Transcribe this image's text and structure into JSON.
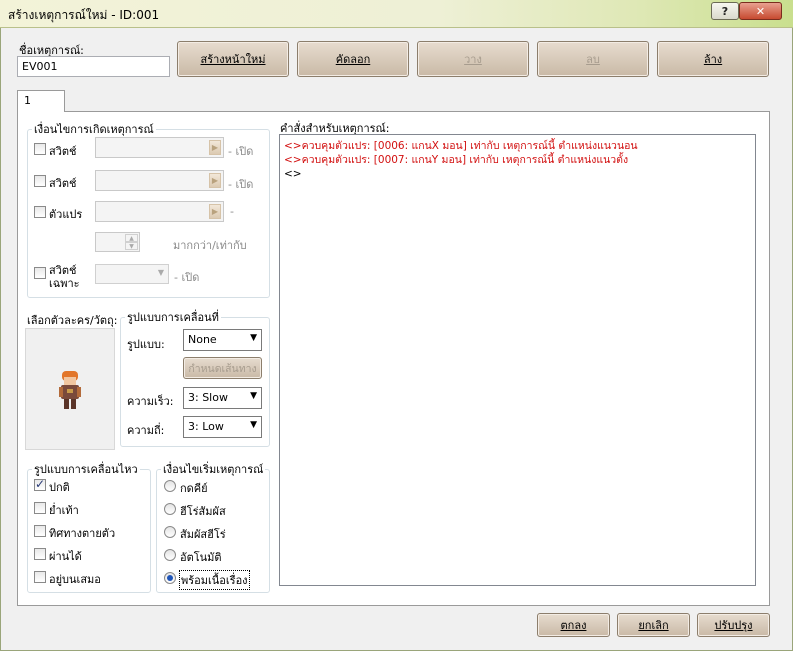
{
  "window": {
    "title": "สร้างเหตุการณ์ใหม่ - ID:001",
    "help_label": "?",
    "close_label": "✕"
  },
  "event_name": {
    "label": "ชื่อเหตุการณ์:",
    "value": "EV001"
  },
  "toolbar": {
    "new_page": "สร้างหน้าใหม่",
    "copy": "คัดลอก",
    "paste": "วาง",
    "delete": "ลบ",
    "clear": "ล้าง"
  },
  "tabs": [
    {
      "label": "1"
    }
  ],
  "conditions": {
    "title": "เงื่อนไขการเกิดเหตุการณ์",
    "switch1": {
      "label": "สวิตช์",
      "suffix": "- เปิด"
    },
    "switch2": {
      "label": "สวิตช์",
      "suffix": "- เปิด"
    },
    "variable": {
      "label": "ตัวแปร",
      "suffix": "-",
      "compare": "มากกว่า/เท่ากับ"
    },
    "self_switch": {
      "label_line1": "สวิตช์",
      "label_line2": "เฉพาะ",
      "suffix": "- เปิด"
    }
  },
  "graphic": {
    "label": "เลือกตัวละคร/วัตถุ:"
  },
  "movement": {
    "title": "รูปแบบการเคลื่อนที่",
    "type_label": "รูปแบบ:",
    "type_value": "None",
    "route_button": "กำหนดเส้นทาง",
    "speed_label": "ความเร็ว:",
    "speed_value": "3: Slow",
    "freq_label": "ความถี่:",
    "freq_value": "3: Low"
  },
  "options": {
    "title": "รูปแบบการเคลื่อนไหว",
    "items": [
      {
        "label": "ปกติ",
        "checked": true
      },
      {
        "label": "ย่ำเท้า",
        "checked": false
      },
      {
        "label": "ทิศทางตายตัว",
        "checked": false
      },
      {
        "label": "ผ่านได้",
        "checked": false
      },
      {
        "label": "อยู่บนเสมอ",
        "checked": false
      }
    ]
  },
  "trigger": {
    "title": "เงื่อนไขเริ่มเหตุการณ์",
    "items": [
      {
        "label": "กดคีย์",
        "selected": false
      },
      {
        "label": "ฮีโร่สัมผัส",
        "selected": false
      },
      {
        "label": "สัมผัสฮีโร่",
        "selected": false
      },
      {
        "label": "อัตโนมัติ",
        "selected": false
      },
      {
        "label": "พร้อมเนื้อเรื่อง",
        "selected": true
      }
    ]
  },
  "commands": {
    "label": "คำสั่งสำหรับเหตุการณ์:",
    "lines": [
      "<>ควบคุมตัวแปร: [0006: แกนX มอน] เท่ากับ เหตุการณ์นี้ ตำแหน่งแนวนอน",
      "<>ควบคุมตัวแปร: [0007: แกนY มอน] เท่ากับ เหตุการณ์นี้ ตำแหน่งแนวตั้ง",
      "<>"
    ]
  },
  "footer": {
    "ok": "ตกลง",
    "cancel": "ยกเลิก",
    "apply": "ปรับปรุง"
  },
  "colors": {
    "command_text": "#d21010",
    "accent": "#1f55b8"
  }
}
